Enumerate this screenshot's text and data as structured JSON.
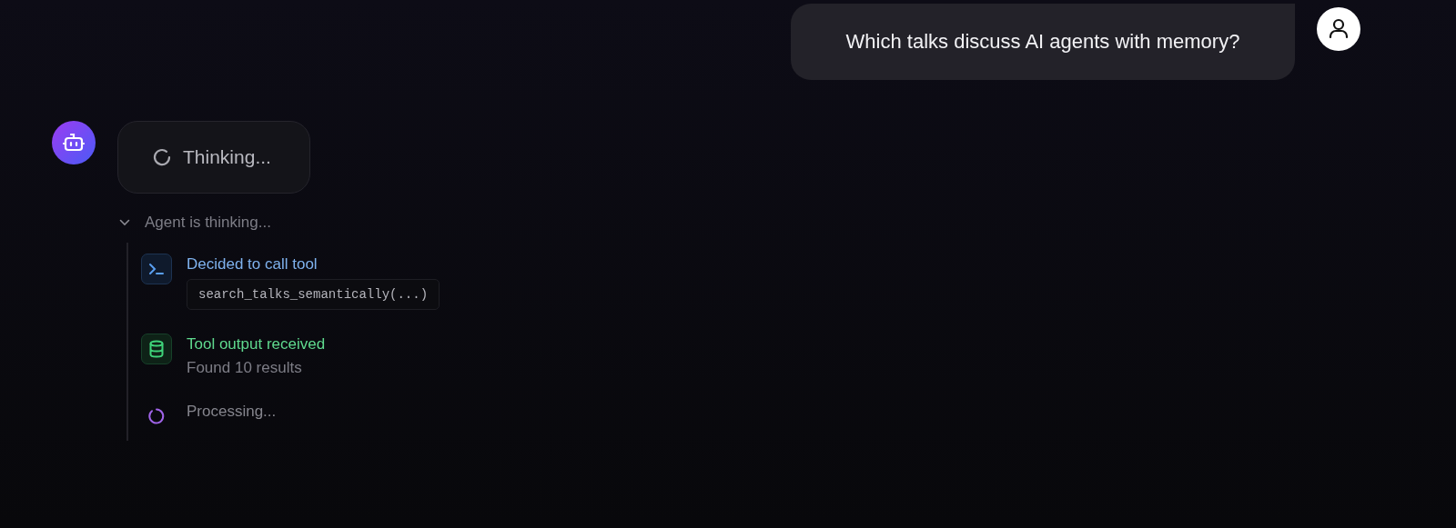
{
  "user_message": {
    "text": "Which talks discuss AI agents with memory?"
  },
  "assistant": {
    "status": "Thinking...",
    "trace": {
      "label": "Agent is thinking...",
      "expanded": true,
      "steps": [
        {
          "kind": "tool_call",
          "title": "Decided to call tool",
          "code": "search_talks_semantically(...)"
        },
        {
          "kind": "tool_output",
          "title": "Tool output received",
          "detail": "Found 10 results"
        },
        {
          "kind": "processing",
          "title": "Processing..."
        }
      ]
    }
  }
}
